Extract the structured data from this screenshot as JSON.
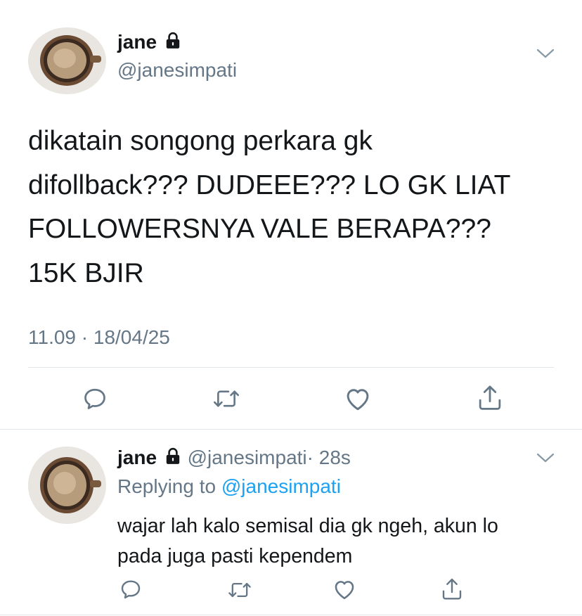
{
  "main_tweet": {
    "author_name": "jane",
    "handle": "@janesimpati",
    "body_lines": [
      "dikatain songong perkara gk",
      "difollback??? DUDEEE??? LO GK LIAT",
      "FOLLOWERSNYA VALE BERAPA???",
      "15K BJIR"
    ],
    "timestamp": "11.09 · 18/04/25",
    "actions": [
      "reply-icon",
      "retweet-icon",
      "like-icon",
      "share-icon"
    ]
  },
  "reply_tweet": {
    "author_name": "jane",
    "handle": "@janesimpati",
    "age": "· 28s",
    "replying_prefix": "Replying to",
    "replying_handle": "@janesimpati",
    "body_lines": [
      "wajar lah kalo semisal dia gk ngeh, akun lo",
      "pada juga pasti kependem"
    ],
    "actions": [
      "reply-icon",
      "retweet-icon",
      "like-icon",
      "share-icon"
    ]
  },
  "colors": {
    "text": "#14171a",
    "muted": "#657786",
    "link": "#1da1f2",
    "divider": "#e1e8ed"
  }
}
